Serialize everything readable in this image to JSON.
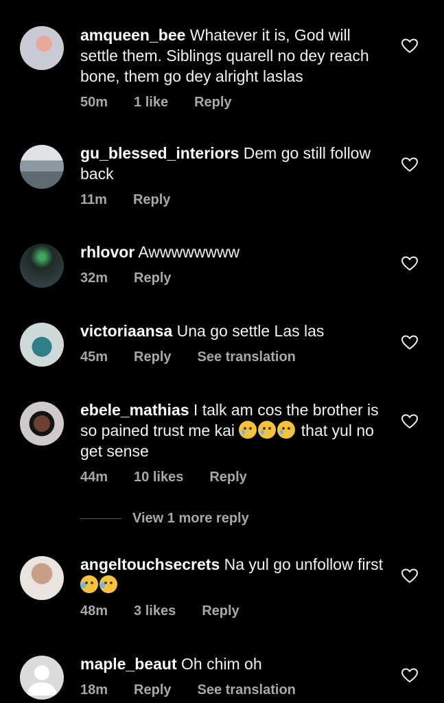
{
  "comments": [
    {
      "username": "amqueen_bee",
      "text": "Whatever it is, God will settle them. Siblings quarell no dey reach bone, them go dey alright laslas",
      "time": "50m",
      "likes": "1 like",
      "reply": "Reply",
      "translation": ""
    },
    {
      "username": "gu_blessed_interiors",
      "text": "Dem go still follow back",
      "time": "11m",
      "likes": "",
      "reply": "Reply",
      "translation": ""
    },
    {
      "username": "rhlovor",
      "text": "Awwwwwwww",
      "time": "32m",
      "likes": "",
      "reply": "Reply",
      "translation": ""
    },
    {
      "username": "victoriaansa",
      "text": "Una go settle Las las",
      "time": "45m",
      "likes": "",
      "reply": "Reply",
      "translation": "See translation"
    },
    {
      "username": "ebele_mathias",
      "text": "I talk am cos the brother is so pained trust me kai",
      "text_after": "that yul no get sense",
      "time": "44m",
      "likes": "10 likes",
      "reply": "Reply",
      "translation": ""
    },
    {
      "username": "angeltouchsecrets",
      "text": "Na yul go unfollow first",
      "time": "48m",
      "likes": "3 likes",
      "reply": "Reply",
      "translation": ""
    },
    {
      "username": "maple_beaut",
      "text": "Oh chim oh",
      "time": "18m",
      "likes": "",
      "reply": "Reply",
      "translation": "See translation"
    }
  ],
  "view_more_replies": "View 1 more reply",
  "colors": {
    "background": "#000000",
    "meta": "#a8a8a8",
    "text": "#f2f2f2"
  }
}
